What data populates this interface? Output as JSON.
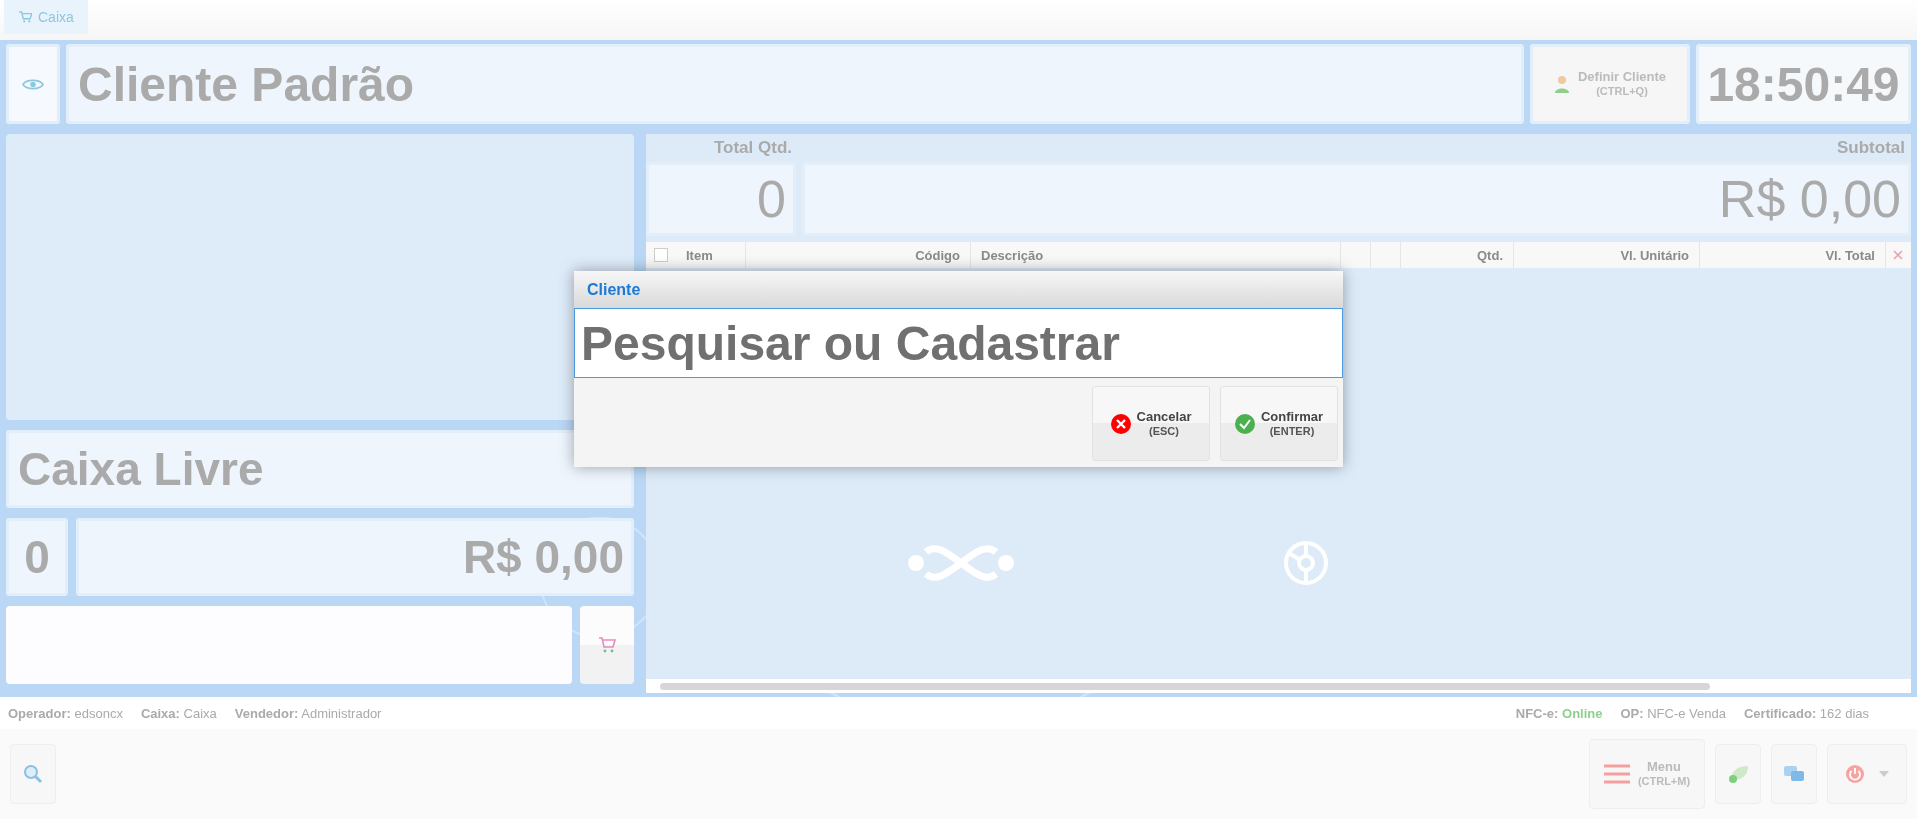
{
  "tabs": [
    {
      "label": "Caixa",
      "selected": true
    }
  ],
  "header": {
    "customer": "Cliente Padrão",
    "define_client": {
      "label": "Definir Cliente",
      "shortcut": "(CTRL+Q)"
    },
    "clock": "18:50:49"
  },
  "left_panel": {
    "status": "Caixa Livre",
    "count": "0",
    "total": "R$ 0,00"
  },
  "totals": {
    "qty_label": "Total Qtd.",
    "subtotal_label": "Subtotal",
    "qty": "0",
    "subtotal": "R$ 0,00"
  },
  "table": {
    "select_all": {
      "checked": false
    },
    "columns": [
      {
        "label": "Item",
        "kind": "left"
      },
      {
        "label": "Código",
        "kind": "right"
      },
      {
        "label": "Descrição",
        "kind": "left"
      },
      {
        "label": "Qtd.",
        "kind": "right"
      },
      {
        "label": "Vl. Unitário",
        "kind": "right"
      },
      {
        "label": "Vl. Total",
        "kind": "right"
      }
    ]
  },
  "status_bar": {
    "left": [
      {
        "label": "Operador:",
        "value": "edsoncx"
      },
      {
        "label": "Caixa:",
        "value": "Caixa"
      },
      {
        "label": "Vendedor:",
        "value": "Administrador"
      }
    ],
    "right": [
      {
        "label": "NFC-e:",
        "value": "Online",
        "online": true
      },
      {
        "label": "OP:",
        "value": "NFC-e Venda"
      },
      {
        "label": "Certificado:",
        "value": "162 dias"
      }
    ]
  },
  "toolbar": {
    "menu": {
      "label": "Menu",
      "shortcut": "(CTRL+M)"
    }
  },
  "dialog": {
    "title": "Cliente",
    "placeholder": "Pesquisar ou Cadastrar",
    "buttons": [
      {
        "label": "Cancelar",
        "shortcut": "(ESC)",
        "kind": "cancel"
      },
      {
        "label": "Confirmar",
        "shortcut": "(ENTER)",
        "kind": "confirm"
      }
    ]
  }
}
